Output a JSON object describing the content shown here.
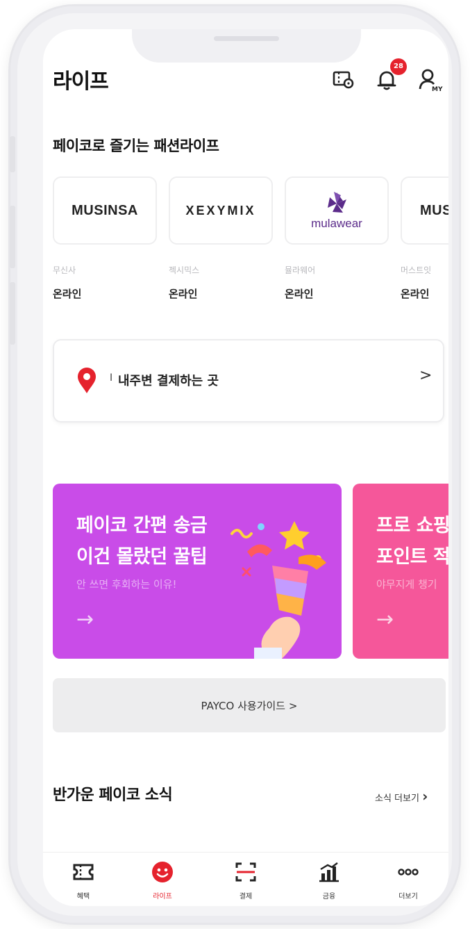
{
  "header": {
    "title": "라이프",
    "notification_count": "28"
  },
  "fashion": {
    "title": "페이코로 즐기는 패션라이프",
    "brands": [
      {
        "logo": "MUSINSA",
        "name": "무신사",
        "kind": "온라인"
      },
      {
        "logo": "XEXYMIX",
        "name": "젝시믹스",
        "kind": "온라인"
      },
      {
        "logo": "mulawear",
        "name": "뮬라웨어",
        "kind": "온라인"
      },
      {
        "logo": "MUS",
        "name": "머스트잇",
        "kind": "온라인"
      }
    ]
  },
  "location": {
    "marker": "I",
    "label": "내주변 결제하는 곳",
    "chevron": ">"
  },
  "banners": [
    {
      "title": "페이코 간편 송금\n이건 몰랐던 꿀팁",
      "subtitle": "안 쓰면 후회하는 이유!",
      "arrow": "→",
      "color": "#c94ce8"
    },
    {
      "title": "프로 쇼핑\n포인트 적",
      "subtitle": "야무지게 챙기",
      "arrow": "→",
      "color": "#f5579a"
    }
  ],
  "guide": {
    "label": "PAYCO 사용가이드  >"
  },
  "news": {
    "title": "반가운 페이코 소식",
    "more": "소식 더보기"
  },
  "tabs": [
    {
      "label": "혜택",
      "icon": "ticket-icon"
    },
    {
      "label": "라이프",
      "icon": "smile-icon"
    },
    {
      "label": "결제",
      "icon": "scan-icon"
    },
    {
      "label": "금융",
      "icon": "chart-icon"
    },
    {
      "label": "더보기",
      "icon": "more-icon"
    }
  ],
  "colors": {
    "accent": "#e5222d",
    "banner1": "#c94ce8",
    "banner2": "#f5579a"
  }
}
